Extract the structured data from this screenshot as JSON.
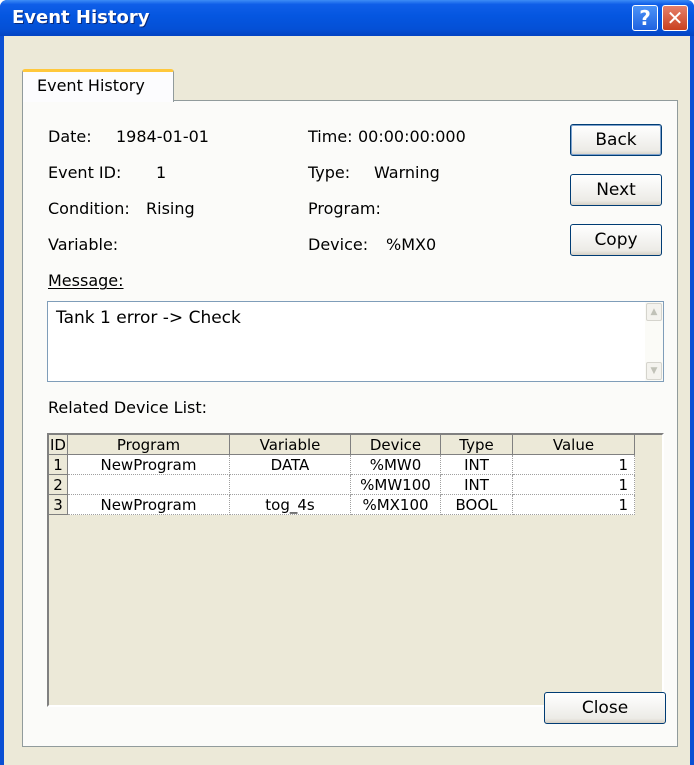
{
  "window": {
    "title": "Event History",
    "help_glyph": "?",
    "close_glyph": "✕"
  },
  "tab": {
    "label": "Event History"
  },
  "info": {
    "date_label": "Date:",
    "date_value": "1984-01-01",
    "time_label": "Time:",
    "time_value": "00:00:00:000",
    "event_id_label": "Event ID:",
    "event_id_value": "1",
    "type_label": "Type:",
    "type_value": "Warning",
    "condition_label": "Condition:",
    "condition_value": "Rising",
    "program_label": "Program:",
    "program_value": "",
    "variable_label": "Variable:",
    "variable_value": "",
    "device_label": "Device:",
    "device_value": "%MX0",
    "message_label": "Message:",
    "message_text": "Tank 1 error -> Check"
  },
  "buttons": {
    "back": "Back",
    "next": "Next",
    "copy": "Copy",
    "close": "Close"
  },
  "related": {
    "label": "Related Device List:",
    "columns": [
      "ID",
      "Program",
      "Variable",
      "Device",
      "Type",
      "Value"
    ],
    "rows": [
      [
        "1",
        "NewProgram",
        "DATA",
        "%MW0",
        "INT",
        "1"
      ],
      [
        "2",
        "",
        "",
        "%MW100",
        "INT",
        "1"
      ],
      [
        "3",
        "NewProgram",
        "tog_4s",
        "%MX100",
        "BOOL",
        "1"
      ]
    ]
  },
  "colors": {
    "titlebar": "#0556e0",
    "dialog_face": "#ece9d8",
    "tab_highlight": "#ffc83c"
  },
  "icons": {
    "help": "help-icon",
    "close": "close-icon",
    "scroll_up": "chevron-up-icon",
    "scroll_down": "chevron-down-icon"
  }
}
